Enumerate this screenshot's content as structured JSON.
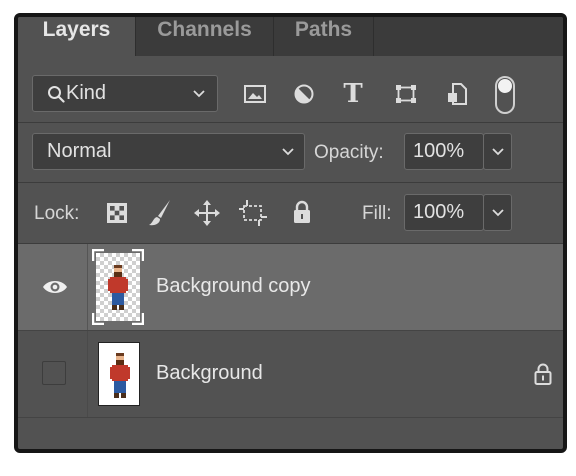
{
  "tabs": [
    {
      "label": "Layers",
      "active": true
    },
    {
      "label": "Channels",
      "active": false
    },
    {
      "label": "Paths",
      "active": false
    }
  ],
  "filter": {
    "kind_label": "Kind",
    "icons": [
      "image-filter-icon",
      "adjustment-filter-icon",
      "type-filter-icon",
      "shape-filter-icon",
      "smart-object-filter-icon",
      "filter-toggle"
    ]
  },
  "blend": {
    "mode": "Normal",
    "opacity_label": "Opacity:",
    "opacity_value": "100%"
  },
  "lock": {
    "label": "Lock:",
    "icons": [
      "lock-transparent-pixels-icon",
      "lock-image-pixels-icon",
      "lock-position-icon",
      "lock-artboard-icon",
      "lock-all-icon"
    ],
    "fill_label": "Fill:",
    "fill_value": "100%"
  },
  "layers": [
    {
      "name": "Background copy",
      "visible": true,
      "selected": true,
      "locked": false
    },
    {
      "name": "Background",
      "visible": false,
      "selected": false,
      "locked": true
    }
  ],
  "colors": {
    "panel": "#525252",
    "selected_row": "#6b6b6b",
    "border": "#161616"
  }
}
